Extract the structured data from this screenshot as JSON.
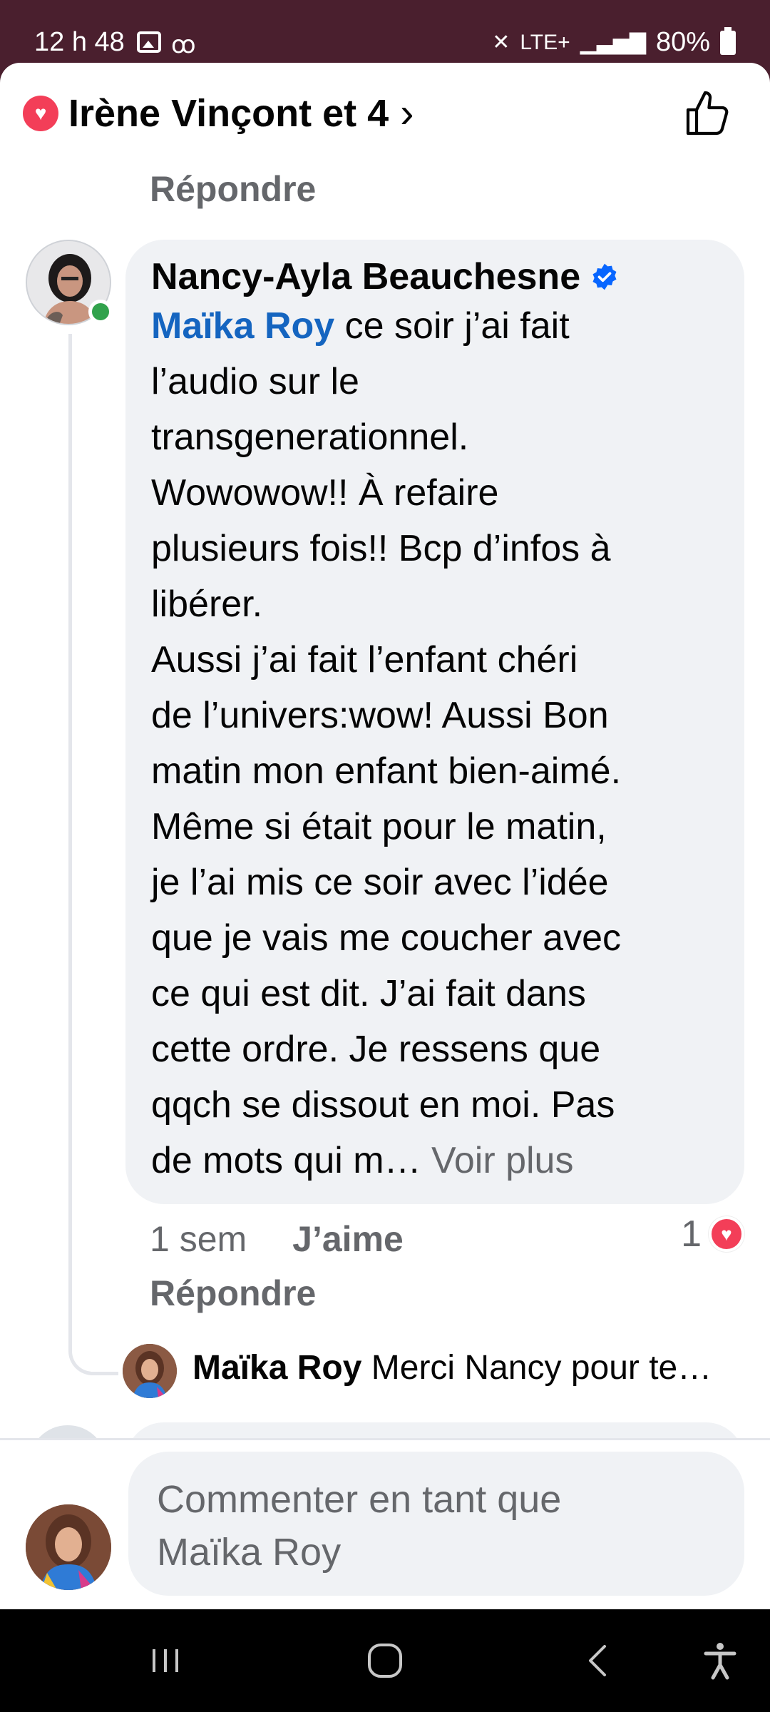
{
  "status_bar": {
    "time": "12 h 48",
    "image_icon": "image-icon",
    "voicemail_icon": "voicemail-icon",
    "mute_icon": "mute-icon",
    "network": "LTE+",
    "signal_icon": "signal-icon",
    "battery": "80%"
  },
  "header": {
    "reaction_icon": "heart-icon",
    "reactions_label": "Irène Vinçont et 4",
    "like_icon": "thumbs-up-icon"
  },
  "previous_comment": {
    "reply_label": "Répondre"
  },
  "comment": {
    "author": "Nancy-Ayla Beauchesne",
    "verified_icon": "verified-badge-icon",
    "mention": "Maïka Roy",
    "text_lines": [
      " ce soir j’ai fait",
      "l’audio sur le",
      "transgenerationnel.",
      "Wowowow!! À refaire",
      "plusieurs fois!! Bcp d’infos à",
      "libérer.",
      "Aussi j’ai fait l’enfant chéri",
      "de l’univers:wow! Aussi Bon",
      "matin mon enfant bien-aimé.",
      "Même si était pour le matin,",
      "je l’ai mis ce soir avec l’idée",
      "que je vais me coucher avec",
      "ce qui est dit. J’ai fait dans",
      "cette ordre. Je ressens que",
      "qqch se dissout en moi. Pas",
      "de mots qui m… "
    ],
    "see_more": "Voir plus",
    "time": "1 sem",
    "like_label": "J’aime",
    "reply_label": "Répondre",
    "reaction_count": "1"
  },
  "reply_preview": {
    "author": "Maïka Roy",
    "text": " Merci Nancy pour te…"
  },
  "composer": {
    "placeholder_line1": "Commenter en tant que",
    "placeholder_line2": "Maïka Roy"
  },
  "colors": {
    "status_bar": "#4a1f2e",
    "mention": "#1565c0",
    "heart": "#f33e58",
    "online": "#31a24c",
    "verified": "#0866ff",
    "bubble": "#f0f2f5",
    "secondary_text": "#65676b"
  },
  "nav_bar": {
    "recents_icon": "recents-icon",
    "home_icon": "home-icon",
    "back_icon": "back-icon",
    "accessibility_icon": "accessibility-icon"
  }
}
